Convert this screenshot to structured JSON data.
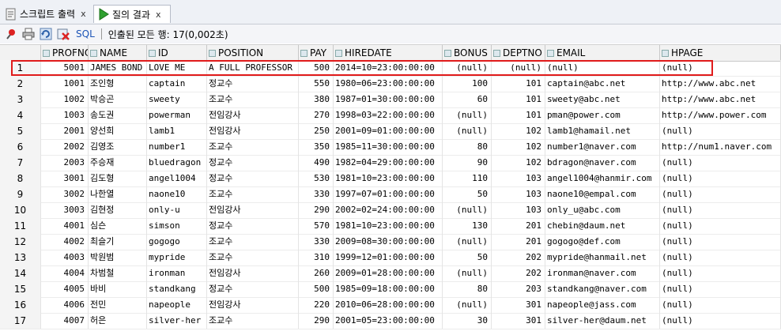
{
  "tabs": [
    {
      "label": "스크립트 출력",
      "close": "x",
      "icon": "script-icon"
    },
    {
      "label": "질의 결과",
      "close": "x",
      "icon": "play-icon"
    }
  ],
  "toolbar": {
    "sql_label": "SQL",
    "status": "인출된 모든 행: 17(0,002초)",
    "icons": [
      "pin-icon",
      "print-icon",
      "refresh-icon",
      "delete-icon"
    ]
  },
  "columns": [
    "PROFNO",
    "NAME",
    "ID",
    "POSITION",
    "PAY",
    "HIREDATE",
    "BONUS",
    "DEPTNO",
    "EMAIL",
    "HPAGE"
  ],
  "rows": [
    [
      "1",
      "5001",
      "JAMES BOND",
      "LOVE ME",
      "A FULL PROFESSOR",
      "500",
      "2014=10=23:00:00:00",
      "(null)",
      "(null)",
      "(null)",
      "(null)"
    ],
    [
      "2",
      "1001",
      "조인형",
      "captain",
      "정교수",
      "550",
      "1980=06=23:00:00:00",
      "100",
      "101",
      "captain@abc.net",
      "http://www.abc.net"
    ],
    [
      "3",
      "1002",
      "박승곤",
      "sweety",
      "조교수",
      "380",
      "1987=01=30:00:00:00",
      "60",
      "101",
      "sweety@abc.net",
      "http://www.abc.net"
    ],
    [
      "4",
      "1003",
      "송도권",
      "powerman",
      "전임강사",
      "270",
      "1998=03=22:00:00:00",
      "(null)",
      "101",
      "pman@power.com",
      "http://www.power.com"
    ],
    [
      "5",
      "2001",
      "양선희",
      "lamb1",
      "전임강사",
      "250",
      "2001=09=01:00:00:00",
      "(null)",
      "102",
      "lamb1@hamail.net",
      "(null)"
    ],
    [
      "6",
      "2002",
      "김영조",
      "number1",
      "조교수",
      "350",
      "1985=11=30:00:00:00",
      "80",
      "102",
      "number1@naver.com",
      "http://num1.naver.com"
    ],
    [
      "7",
      "2003",
      "주승재",
      "bluedragon",
      "정교수",
      "490",
      "1982=04=29:00:00:00",
      "90",
      "102",
      "bdragon@naver.com",
      "(null)"
    ],
    [
      "8",
      "3001",
      "김도형",
      "angel1004",
      "정교수",
      "530",
      "1981=10=23:00:00:00",
      "110",
      "103",
      "angel1004@hanmir.com",
      "(null)"
    ],
    [
      "9",
      "3002",
      "나한열",
      "naone10",
      "조교수",
      "330",
      "1997=07=01:00:00:00",
      "50",
      "103",
      "naone10@empal.com",
      "(null)"
    ],
    [
      "10",
      "3003",
      "김현정",
      "only-u",
      "전임강사",
      "290",
      "2002=02=24:00:00:00",
      "(null)",
      "103",
      "only_u@abc.com",
      "(null)"
    ],
    [
      "11",
      "4001",
      "심슨",
      "simson",
      "정교수",
      "570",
      "1981=10=23:00:00:00",
      "130",
      "201",
      "chebin@daum.net",
      "(null)"
    ],
    [
      "12",
      "4002",
      "최슬기",
      "gogogo",
      "조교수",
      "330",
      "2009=08=30:00:00:00",
      "(null)",
      "201",
      "gogogo@def.com",
      "(null)"
    ],
    [
      "13",
      "4003",
      "박원범",
      "mypride",
      "조교수",
      "310",
      "1999=12=01:00:00:00",
      "50",
      "202",
      "mypride@hanmail.net",
      "(null)"
    ],
    [
      "14",
      "4004",
      "차범철",
      "ironman",
      "전임강사",
      "260",
      "2009=01=28:00:00:00",
      "(null)",
      "202",
      "ironman@naver.com",
      "(null)"
    ],
    [
      "15",
      "4005",
      "바비",
      "standkang",
      "정교수",
      "500",
      "1985=09=18:00:00:00",
      "80",
      "203",
      "standkang@naver.com",
      "(null)"
    ],
    [
      "16",
      "4006",
      "전민",
      "napeople",
      "전임강사",
      "220",
      "2010=06=28:00:00:00",
      "(null)",
      "301",
      "napeople@jass.com",
      "(null)"
    ],
    [
      "17",
      "4007",
      "허은",
      "silver-her",
      "조교수",
      "290",
      "2001=05=23:00:00:00",
      "30",
      "301",
      "silver-her@daum.net",
      "(null)"
    ]
  ]
}
